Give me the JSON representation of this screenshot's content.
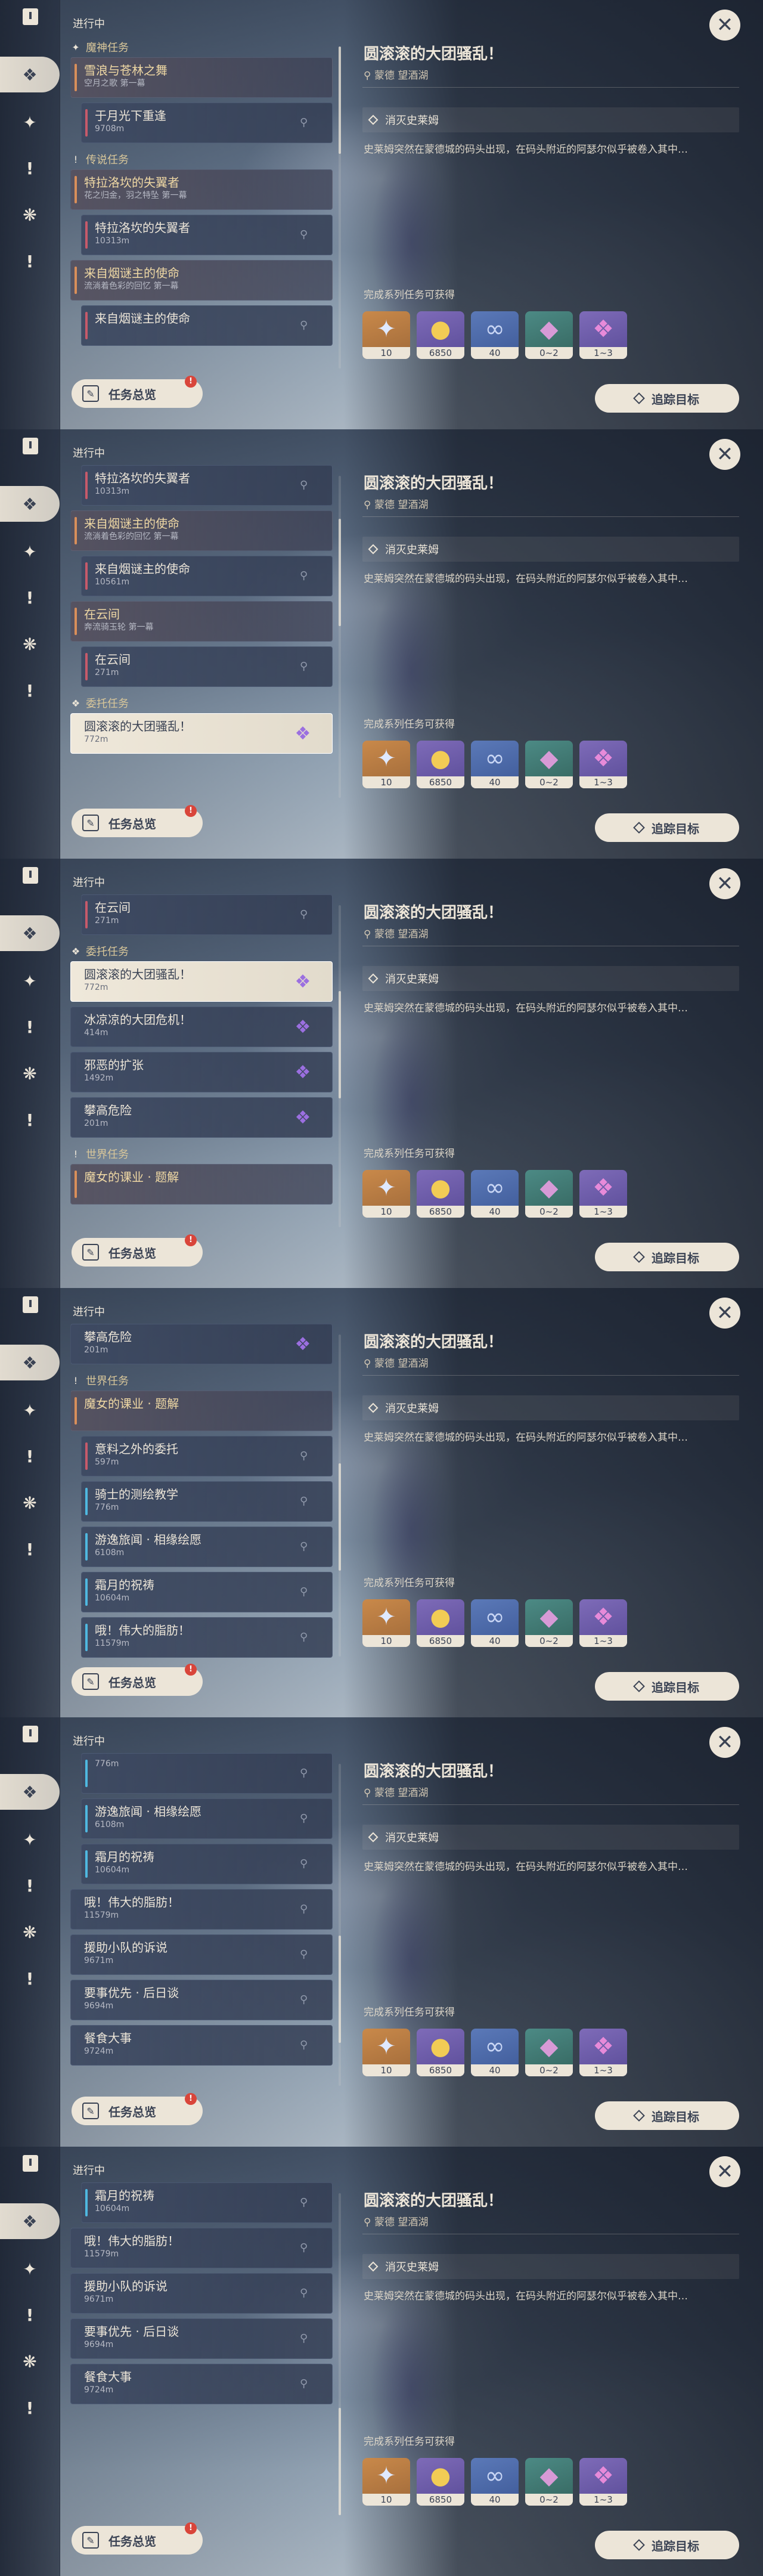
{
  "sidebar": {
    "icons": [
      "quest-book-icon",
      "commission-icon",
      "archon-quest-icon",
      "story-quest-icon",
      "world-quest-icon",
      "event-quest-icon"
    ]
  },
  "common": {
    "section_in_progress": "进行中",
    "overview_label": "任务总览",
    "overview_badge": "!",
    "track_label": "追踪目标",
    "close_glyph": "✕"
  },
  "detail": {
    "title": "圆滚滚的大团骚乱！",
    "location": "蒙德 望酒湖",
    "objective": "消灭史莱姆",
    "description": "史莱姆突然在蒙德城的码头出现，在码头附近的阿瑟尔似乎被卷入其中…",
    "rewards_label": "完成系列任务可获得",
    "rewards": [
      {
        "icon": "adventure-exp-icon",
        "count": "10",
        "color": "orange"
      },
      {
        "icon": "mora-icon",
        "count": "6850",
        "color": "purple"
      },
      {
        "icon": "friendship-exp-icon",
        "count": "40",
        "color": "blue"
      },
      {
        "icon": "crystal-chunk-icon",
        "count": "0~2",
        "color": "green"
      },
      {
        "icon": "crystal-cluster-icon",
        "count": "1~3",
        "color": "purple"
      }
    ]
  },
  "screens": [
    {
      "scroll_fraction": 0.0,
      "items": [
        {
          "type": "cat",
          "icon": "archon",
          "label": "魔神任务"
        },
        {
          "type": "header",
          "title": "雪浪与苍林之舞",
          "sub": "空月之歌 第一幕"
        },
        {
          "type": "sub",
          "title": "于月光下重逢",
          "sub": "9708m"
        },
        {
          "type": "cat",
          "icon": "story",
          "label": "传说任务"
        },
        {
          "type": "header",
          "title": "特拉洛坎的失翼者",
          "sub": "花之归金，羽之特坠 第一幕"
        },
        {
          "type": "sub",
          "title": "特拉洛坎的失翼者",
          "sub": "10313m"
        },
        {
          "type": "header",
          "title": "来自烟谜主的使命",
          "sub": "流淌着色彩的回忆 第一幕"
        },
        {
          "type": "sub",
          "title": "来自烟谜主的使命",
          "sub": ""
        }
      ]
    },
    {
      "scroll_fraction": 0.2,
      "items": [
        {
          "type": "sub",
          "title": "特拉洛坎的失翼者",
          "sub": "10313m"
        },
        {
          "type": "header",
          "title": "来自烟谜主的使命",
          "sub": "流淌着色彩的回忆 第一幕"
        },
        {
          "type": "sub",
          "title": "来自烟谜主的使命",
          "sub": "10561m"
        },
        {
          "type": "header",
          "title": "在云间",
          "sub": "奔流骑玉轮 第一幕"
        },
        {
          "type": "sub",
          "title": "在云间",
          "sub": "271m"
        },
        {
          "type": "cat",
          "icon": "commission",
          "label": "委托任务"
        },
        {
          "type": "selected",
          "title": "圆滚滚的大团骚乱！",
          "sub": "772m"
        }
      ]
    },
    {
      "scroll_fraction": 0.4,
      "items": [
        {
          "type": "sub",
          "title": "在云间",
          "sub": "271m"
        },
        {
          "type": "cat",
          "icon": "commission",
          "label": "委托任务"
        },
        {
          "type": "selected",
          "title": "圆滚滚的大团骚乱！",
          "sub": "772m"
        },
        {
          "type": "commission",
          "title": "冰凉凉的大团危机！",
          "sub": "414m"
        },
        {
          "type": "commission",
          "title": "邪恶的扩张",
          "sub": "1492m"
        },
        {
          "type": "commission",
          "title": "攀高危险",
          "sub": "201m"
        },
        {
          "type": "cat",
          "icon": "world",
          "label": "世界任务"
        },
        {
          "type": "header",
          "title": "魔女的课业 · 题解",
          "sub": ""
        }
      ]
    },
    {
      "scroll_fraction": 0.6,
      "items": [
        {
          "type": "commission",
          "title": "攀高危险",
          "sub": "201m"
        },
        {
          "type": "cat",
          "icon": "world",
          "label": "世界任务"
        },
        {
          "type": "header",
          "title": "魔女的课业 · 题解",
          "sub": ""
        },
        {
          "type": "sub",
          "title": "意料之外的委托",
          "sub": "597m"
        },
        {
          "type": "world",
          "title": "骑士的测绘教学",
          "sub": "776m"
        },
        {
          "type": "world",
          "title": "游逸旅闻 · 相缘绘愿",
          "sub": "6108m"
        },
        {
          "type": "world",
          "title": "霜月的祝祷",
          "sub": "10604m"
        },
        {
          "type": "world",
          "title": "哦！伟大的脂肪！",
          "sub": "11579m"
        }
      ]
    },
    {
      "scroll_fraction": 0.8,
      "items": [
        {
          "type": "world",
          "title": "",
          "sub": "776m"
        },
        {
          "type": "world",
          "title": "游逸旅闻 · 相缘绘愿",
          "sub": "6108m"
        },
        {
          "type": "world",
          "title": "霜月的祝祷",
          "sub": "10604m"
        },
        {
          "type": "plain",
          "title": "哦！伟大的脂肪！",
          "sub": "11579m"
        },
        {
          "type": "plain",
          "title": "援助小队的诉说",
          "sub": "9671m"
        },
        {
          "type": "plain",
          "title": "要事优先 · 后日谈",
          "sub": "9694m"
        },
        {
          "type": "plain",
          "title": "餐食大事",
          "sub": "9724m"
        }
      ]
    },
    {
      "scroll_fraction": 1.0,
      "items": [
        {
          "type": "world",
          "title": "霜月的祝祷",
          "sub": "10604m"
        },
        {
          "type": "plain",
          "title": "哦！伟大的脂肪！",
          "sub": "11579m"
        },
        {
          "type": "plain",
          "title": "援助小队的诉说",
          "sub": "9671m"
        },
        {
          "type": "plain",
          "title": "要事优先 · 后日谈",
          "sub": "9694m"
        },
        {
          "type": "plain",
          "title": "餐食大事",
          "sub": "9724m"
        }
      ]
    }
  ]
}
